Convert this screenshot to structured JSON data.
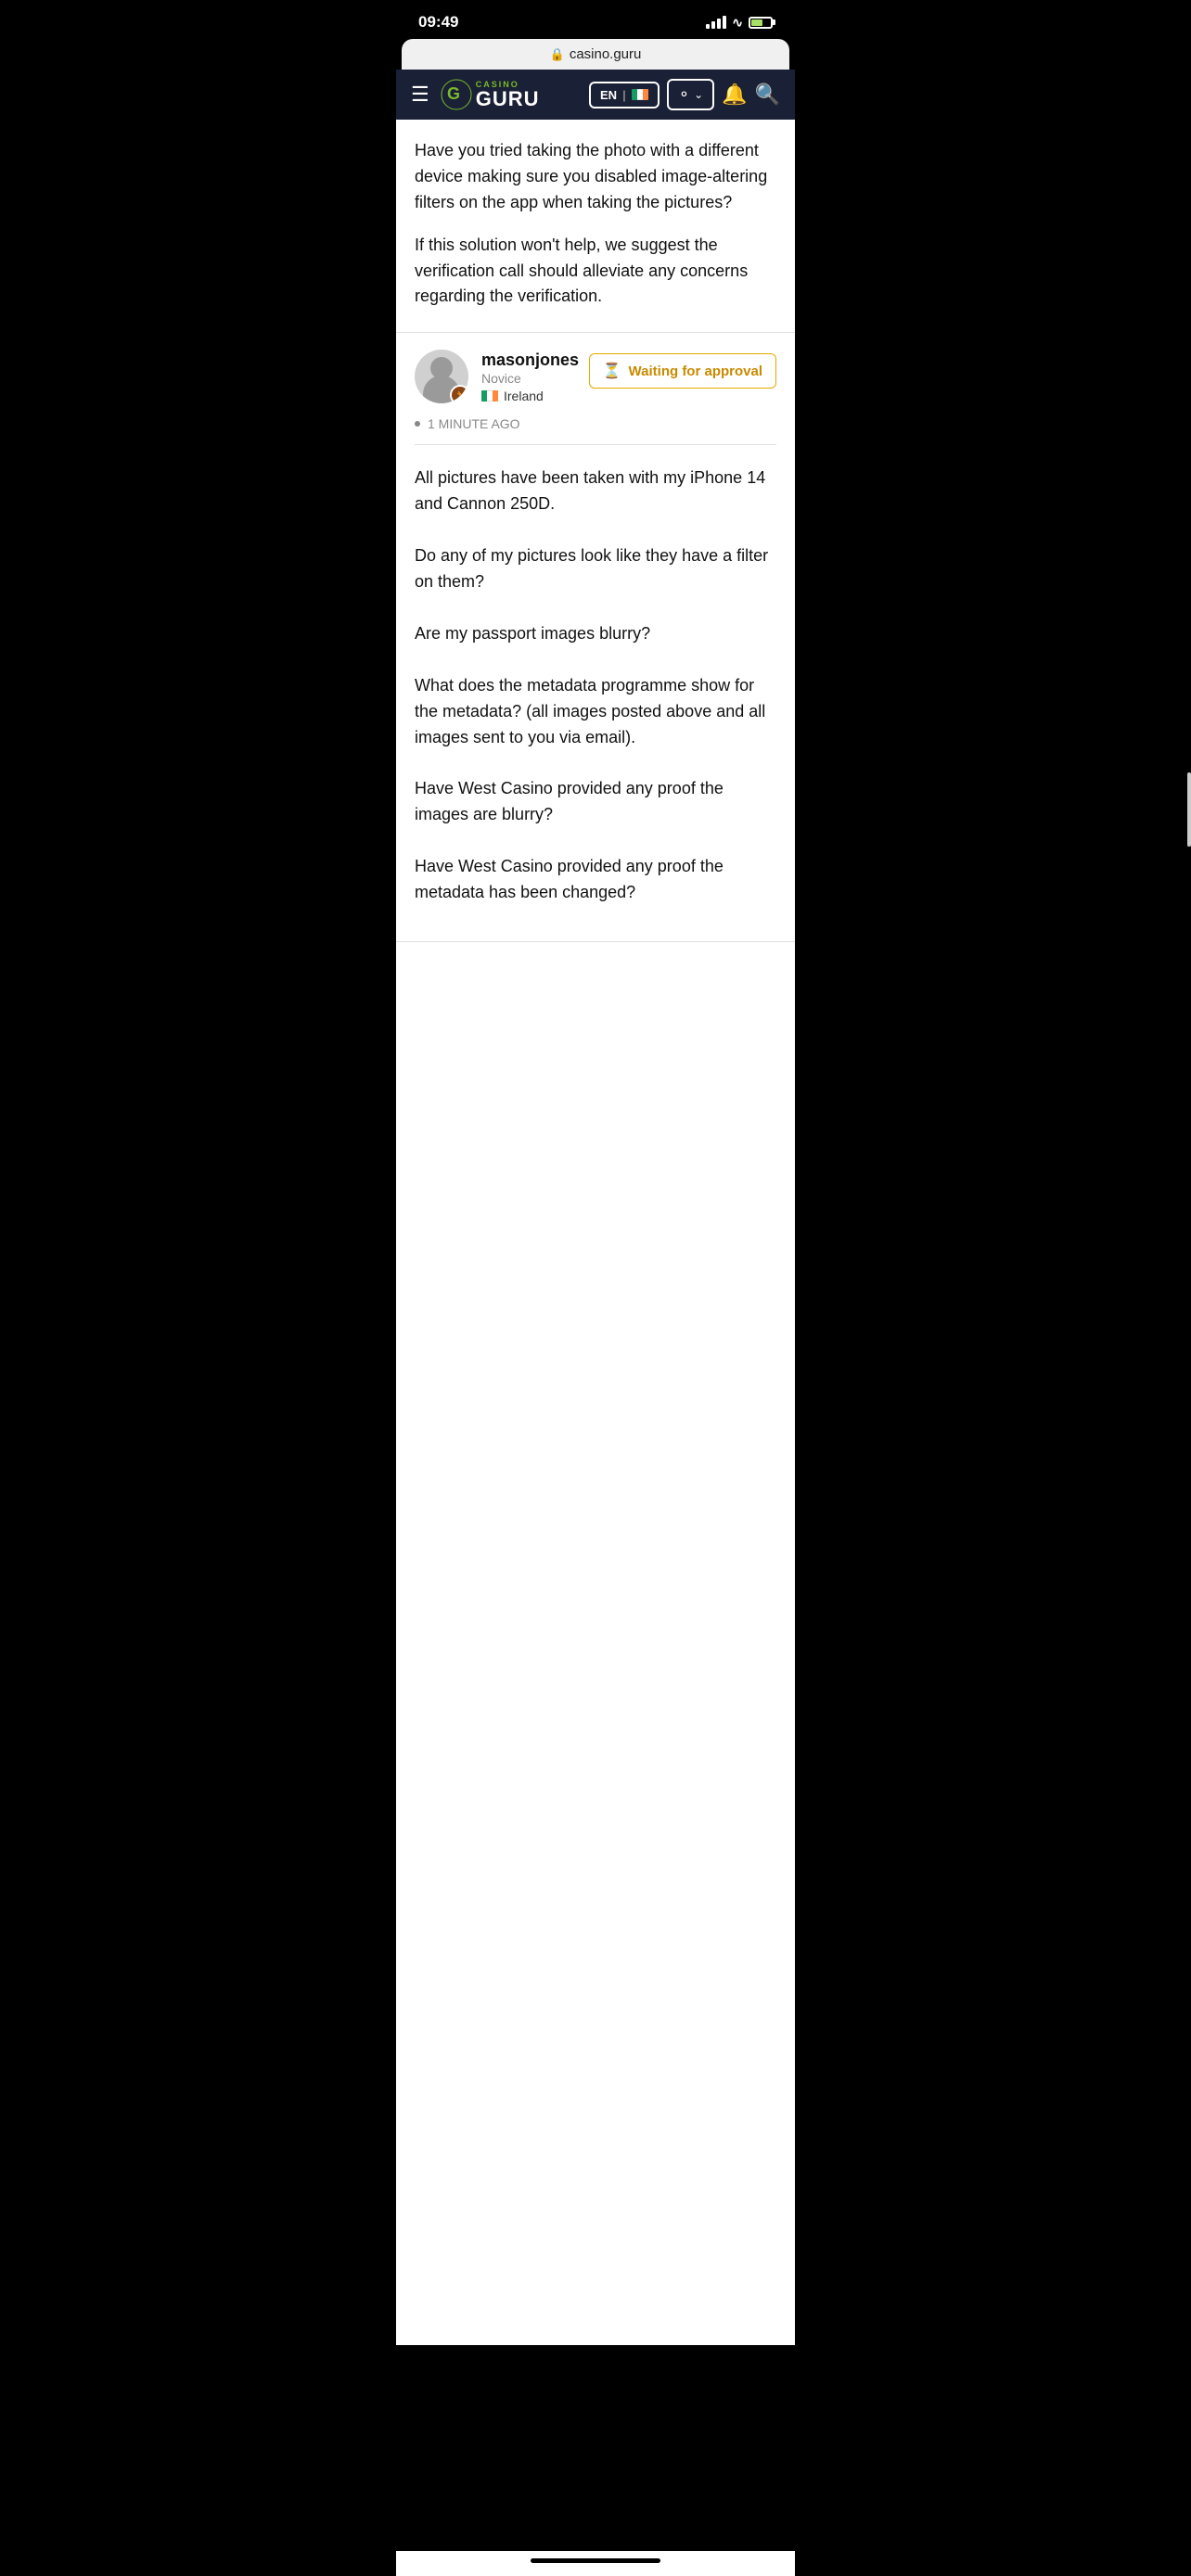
{
  "statusBar": {
    "time": "09:49"
  },
  "addressBar": {
    "url": "casino.guru",
    "lock_label": "🔒"
  },
  "navbar": {
    "logo_casino": "CASINO",
    "logo_guru": "GURU",
    "lang": "EN",
    "country": "Ireland"
  },
  "previousMessage": {
    "paragraph1": "Have you tried taking the photo with a different device making sure you disabled image-altering filters on the app when taking the pictures?",
    "paragraph2": "If this solution won't help, we suggest the verification call should alleviate any concerns regarding the verification."
  },
  "userPost": {
    "username": "masonjones",
    "role": "Novice",
    "country": "Ireland",
    "timestamp": "1 MINUTE AGO",
    "approvalStatus": "Waiting for approval",
    "paragraphs": [
      "All pictures have been taken with my iPhone 14 and Cannon 250D.",
      "Do any of my pictures look like they have a filter on them?",
      "Are my passport images blurry?",
      "What does the metadata programme show for the metadata? (all images posted above and all images sent to you via email).",
      "Have West Casino provided any proof the images are blurry?",
      "Have West Casino provided any proof the metadata has been changed?"
    ]
  }
}
